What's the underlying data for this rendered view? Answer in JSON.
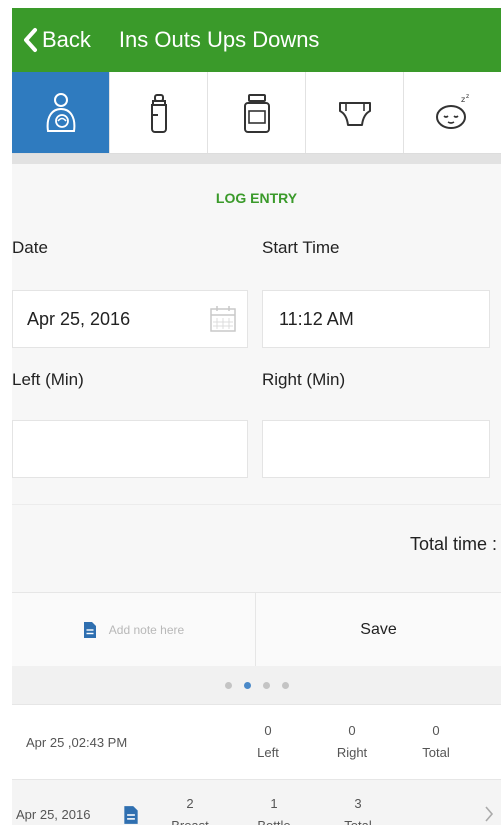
{
  "header": {
    "back_label": "Back",
    "title": "Ins Outs Ups Downs",
    "color": "#3a9a2a"
  },
  "tabs": [
    {
      "name": "breastfeeding-icon",
      "active": true
    },
    {
      "name": "bottle-icon",
      "active": false
    },
    {
      "name": "jar-icon",
      "active": false
    },
    {
      "name": "diaper-icon",
      "active": false
    },
    {
      "name": "sleeping-baby-icon",
      "active": false
    }
  ],
  "form": {
    "heading": "LOG ENTRY",
    "date_label": "Date",
    "date_value": "Apr 25, 2016",
    "start_time_label": "Start Time",
    "start_time_value": "11:12 AM",
    "left_label": "Left (Min)",
    "right_label": "Right (Min)",
    "left_value": "",
    "right_value": "",
    "total_time_label": "Total time :"
  },
  "actions": {
    "note_placeholder": "Add note here",
    "save_label": "Save"
  },
  "pager": {
    "count": 4,
    "active_index": 1
  },
  "session": {
    "time": "Apr 25 ,02:43 PM",
    "left_value": "0",
    "left_label": "Left",
    "right_value": "0",
    "right_label": "Right",
    "total_value": "0",
    "total_label": "Total"
  },
  "summary": {
    "date": "Apr 25, 2016",
    "breast_value": "2",
    "breast_label": "Breast",
    "bottle_value": "1",
    "bottle_label": "Bottle",
    "total_value": "3",
    "total_label": "Total"
  }
}
